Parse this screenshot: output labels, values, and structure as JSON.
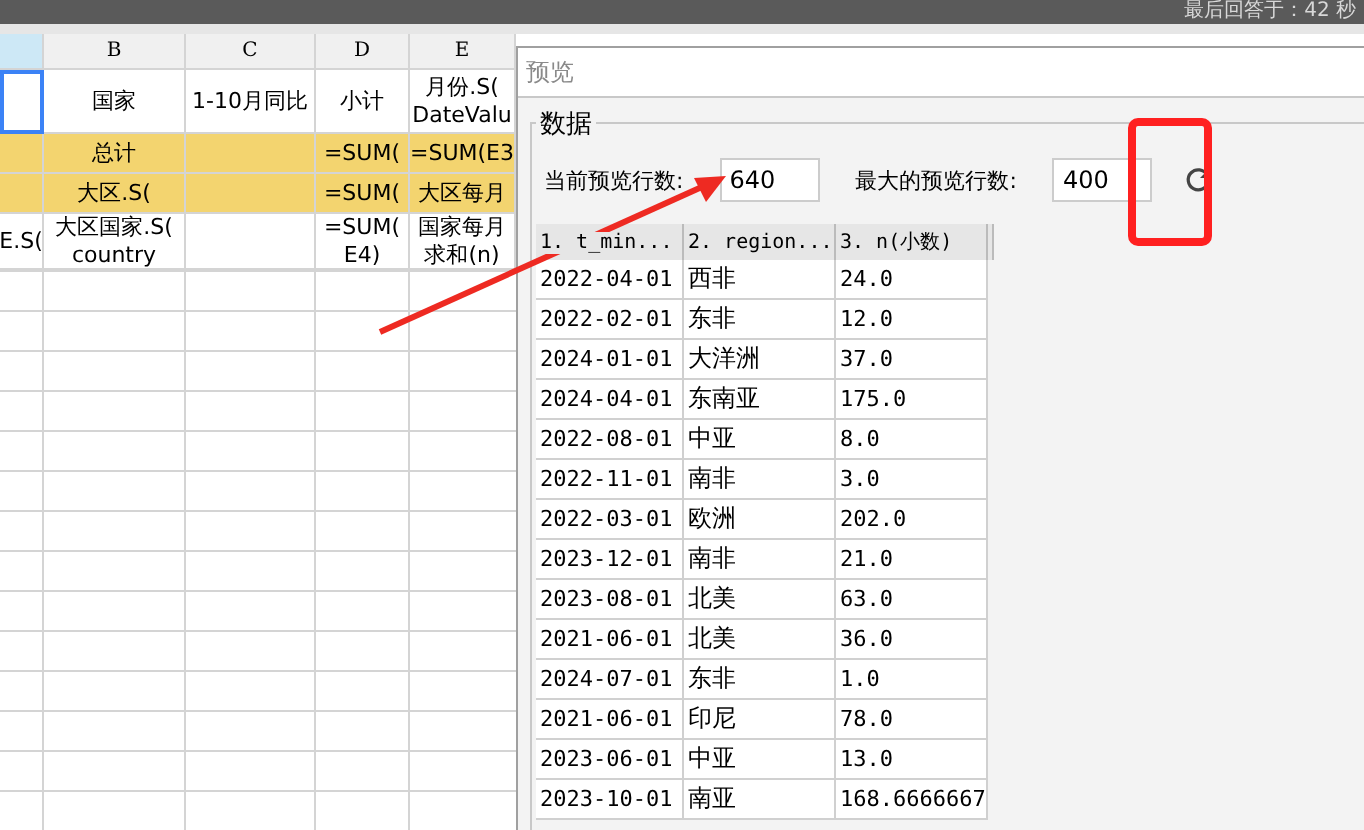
{
  "top_bar": {
    "status": "最后回答于：42 秒"
  },
  "sheet": {
    "columns": [
      {
        "selected": true
      },
      {
        "label": "B",
        "selected": false
      },
      {
        "label": "C",
        "selected": false
      },
      {
        "label": "D",
        "selected": false
      },
      {
        "label": "E",
        "selected": false
      }
    ],
    "rows": [
      {
        "highlighted": false,
        "cells": [
          {
            "selected": true
          },
          {
            "lines": [
              "国家"
            ],
            "selected": false
          },
          {
            "lines": [
              "1-10月同比"
            ],
            "selected": false
          },
          {
            "lines": [
              "小计"
            ],
            "selected": false
          },
          {
            "lines": [
              "月份.S(",
              "DateValu"
            ],
            "selected": false
          }
        ]
      },
      {
        "highlighted": true,
        "cells": [
          {
            "selected": false
          },
          {
            "lines": [
              "总计"
            ],
            "selected": false
          },
          {
            "selected": false
          },
          {
            "lines": [
              "=SUM("
            ],
            "selected": false
          },
          {
            "lines": [
              "=SUM(E3"
            ],
            "selected": false
          }
        ]
      },
      {
        "highlighted": true,
        "cells": [
          {
            "selected": false
          },
          {
            "lines": [
              "大区.S("
            ],
            "selected": false
          },
          {
            "selected": false
          },
          {
            "lines": [
              "=SUM("
            ],
            "selected": false
          },
          {
            "lines": [
              "大区每月"
            ],
            "selected": false
          }
        ]
      },
      {
        "highlighted": false,
        "cells": [
          {
            "lines": [
              "E.S("
            ],
            "selected": false
          },
          {
            "lines": [
              "大区国家.S(",
              "country"
            ],
            "selected": false
          },
          {
            "selected": false
          },
          {
            "lines": [
              "=SUM(",
              "E4)"
            ],
            "selected": false
          },
          {
            "lines": [
              "国家每月",
              "求和(n)"
            ],
            "selected": false
          }
        ]
      }
    ]
  },
  "dialog": {
    "title": "预览",
    "group": "数据",
    "fields": [
      {
        "label": "当前预览行数:",
        "value": "640"
      },
      {
        "label": "最大的预览行数:",
        "value": "400"
      }
    ],
    "table": {
      "columns": [
        "1. t_min...",
        "2. region...",
        "3. n(小数)"
      ],
      "rows": [
        [
          "2022-04-01",
          "西非",
          "24.0"
        ],
        [
          "2022-02-01",
          "东非",
          "12.0"
        ],
        [
          "2024-01-01",
          "大洋洲",
          "37.0"
        ],
        [
          "2024-04-01",
          "东南亚",
          "175.0"
        ],
        [
          "2022-08-01",
          "中亚",
          "8.0"
        ],
        [
          "2022-11-01",
          "南非",
          "3.0"
        ],
        [
          "2022-03-01",
          "欧洲",
          "202.0"
        ],
        [
          "2023-12-01",
          "南非",
          "21.0"
        ],
        [
          "2023-08-01",
          "北美",
          "63.0"
        ],
        [
          "2021-06-01",
          "北美",
          "36.0"
        ],
        [
          "2024-07-01",
          "东非",
          "1.0"
        ],
        [
          "2021-06-01",
          "印尼",
          "78.0"
        ],
        [
          "2023-06-01",
          "中亚",
          "13.0"
        ],
        [
          "2023-10-01",
          "南亚",
          "168.6666667"
        ]
      ]
    }
  }
}
